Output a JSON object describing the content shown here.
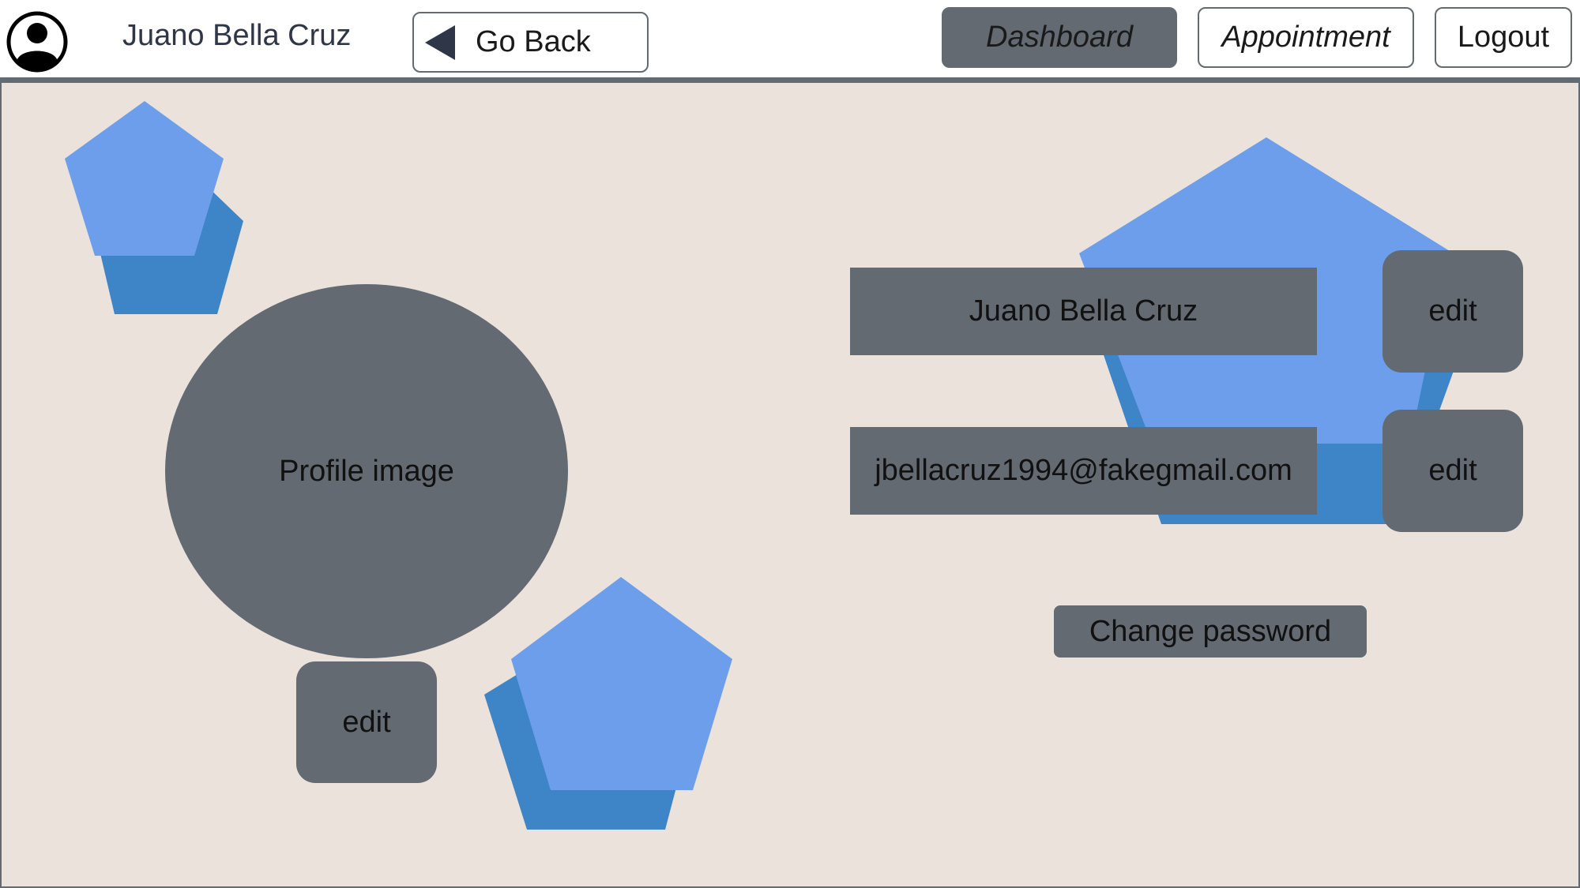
{
  "header": {
    "username": "Juano Bella Cruz",
    "go_back_label": "Go Back",
    "nav": {
      "dashboard_label": "Dashboard",
      "appointment_label": "Appointment",
      "logout_label": "Logout"
    }
  },
  "profile": {
    "image_label": "Profile image",
    "image_edit_label": "edit",
    "name_value": "Juano Bella Cruz",
    "name_edit_label": "edit",
    "email_value": "jbellacruz1994@fakegmail.com",
    "email_edit_label": "edit",
    "change_password_label": "Change password"
  },
  "icons": {
    "avatar": "user-avatar-icon",
    "back": "triangle-left-icon",
    "decorations": "pentagon-shape"
  },
  "colors": {
    "topbar_background": "#ffffff",
    "divider": "#636a72",
    "content_background": "#ebe2db",
    "gray_block": "#636a72",
    "pentagon_light": "#6d9eeb",
    "pentagon_dark": "#3d85c6",
    "text_dark": "#2f3648"
  }
}
